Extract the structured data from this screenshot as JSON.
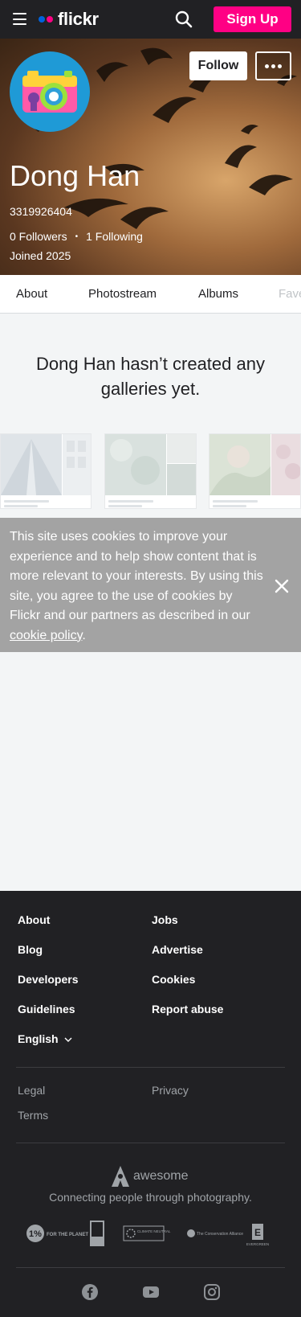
{
  "topnav": {
    "logo_text": "flickr",
    "signup_label": "Sign Up",
    "brand_colors": {
      "blue": "#0063dc",
      "pink": "#ff0084"
    }
  },
  "profile": {
    "name": "Dong Han",
    "user_id": "3319926404",
    "followers": "0 Followers",
    "following": "1 Following",
    "separator": "•",
    "joined": "Joined 2025",
    "follow_label": "Follow"
  },
  "tabs": [
    {
      "label": "About"
    },
    {
      "label": "Photostream"
    },
    {
      "label": "Albums"
    },
    {
      "label": "Faves"
    }
  ],
  "empty_state": {
    "message": "Dong Han hasn’t created any galleries yet."
  },
  "cookie": {
    "text": "This site uses cookies to improve your experience and to help show content that is more relevant to your interests. By using this site, you agree to the use of cookies by Flickr and our partners as described in our",
    "link_label": "cookie policy",
    "trailing": "."
  },
  "footer": {
    "col1": [
      "About",
      "Blog",
      "Developers",
      "Guidelines"
    ],
    "col2": [
      "Jobs",
      "Advertise",
      "Cookies",
      "Report abuse"
    ],
    "language": "English",
    "legal": [
      "Legal",
      "Terms"
    ],
    "privacy": "Privacy",
    "awesome_label": "awesome",
    "tagline": "Connecting people through photography.",
    "badges": [
      {
        "name": "1% for the planet",
        "text": "FOR THE PLANET"
      },
      {
        "name": "great place to work",
        "text": "Great Place To Work"
      },
      {
        "name": "climate neutral",
        "text": "CLIMATE NEUTRAL"
      },
      {
        "name": "the conservation alliance",
        "text": "The Conservation Alliance"
      },
      {
        "name": "evergreen",
        "text": "EVERGREEN"
      }
    ],
    "social_icons": [
      "facebook-icon",
      "youtube-icon",
      "instagram-icon"
    ]
  }
}
